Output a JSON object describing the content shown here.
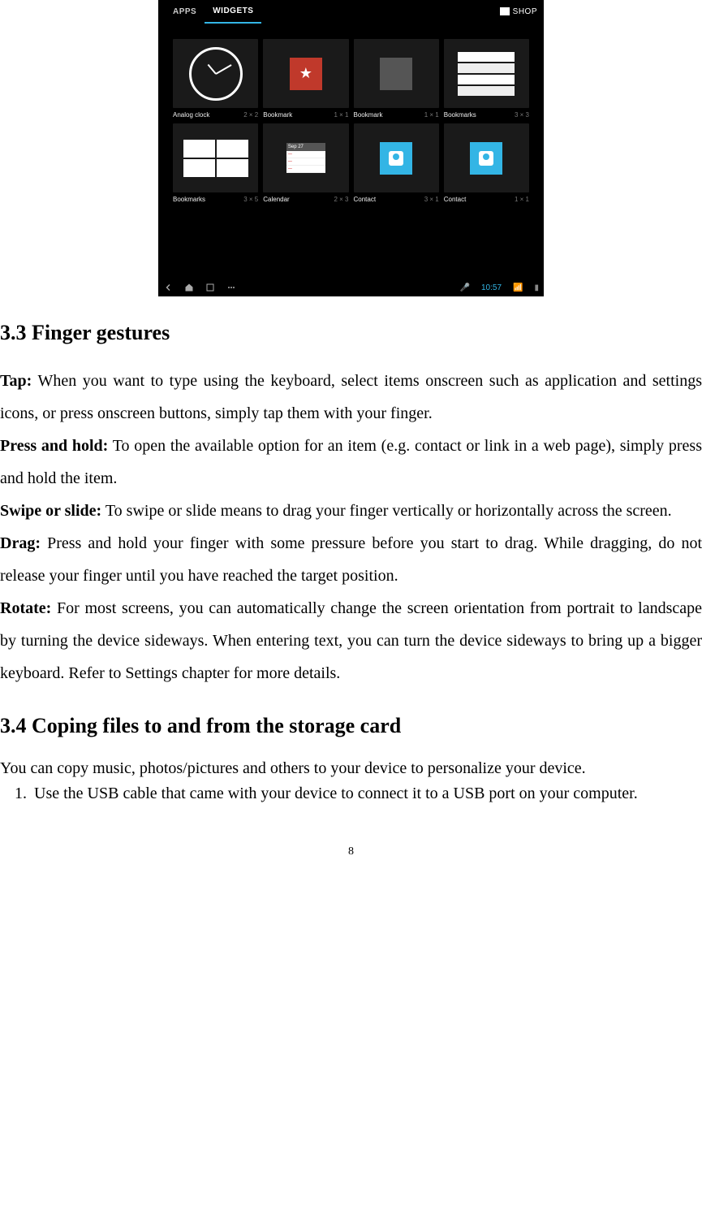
{
  "screenshot": {
    "tabs": {
      "apps": "APPS",
      "widgets": "WIDGETS"
    },
    "shop": "SHOP",
    "widgets": [
      {
        "name": "Analog clock",
        "size": "2 × 2"
      },
      {
        "name": "Bookmark",
        "size": "1 × 1"
      },
      {
        "name": "Bookmark",
        "size": "1 × 1"
      },
      {
        "name": "Bookmarks",
        "size": "3 × 3"
      },
      {
        "name": "Bookmarks",
        "size": "3 × 5"
      },
      {
        "name": "Calendar",
        "size": "2 × 3"
      },
      {
        "name": "Contact",
        "size": "3 × 1"
      },
      {
        "name": "Contact",
        "size": "1 × 1"
      }
    ],
    "calendar_date": "Sep 27",
    "status_time": "10:57"
  },
  "section33": {
    "heading": "3.3 Finger gestures",
    "tap_label": "Tap:",
    "tap_text": " When you want to type using the keyboard, select items onscreen such as application and settings icons, or press onscreen buttons, simply tap them with your finger.",
    "press_label": "Press and hold:",
    "press_text": " To open the available option for an item (e.g. contact or link in a web page), simply press and hold the item.",
    "swipe_label": "Swipe or slide:",
    "swipe_text": " To swipe or slide means to drag your finger vertically or horizontally across the screen.",
    "drag_label": "Drag:",
    "drag_text": " Press and hold your finger with some pressure before you start to drag. While dragging, do not release your finger until you have reached the target position.",
    "rotate_label": "Rotate:",
    "rotate_text": " For most screens, you can automatically change the screen orientation from portrait to landscape by turning the device sideways. When entering text, you can turn the device sideways to bring up a bigger keyboard. Refer to Settings chapter for more details."
  },
  "section34": {
    "heading": "3.4 Coping files to and from the storage card",
    "intro": "You can copy music, photos/pictures and others to your device to personalize your device.",
    "item1": "Use the USB cable that came with your device to connect it to a USB port on your computer."
  },
  "page_number": "8"
}
